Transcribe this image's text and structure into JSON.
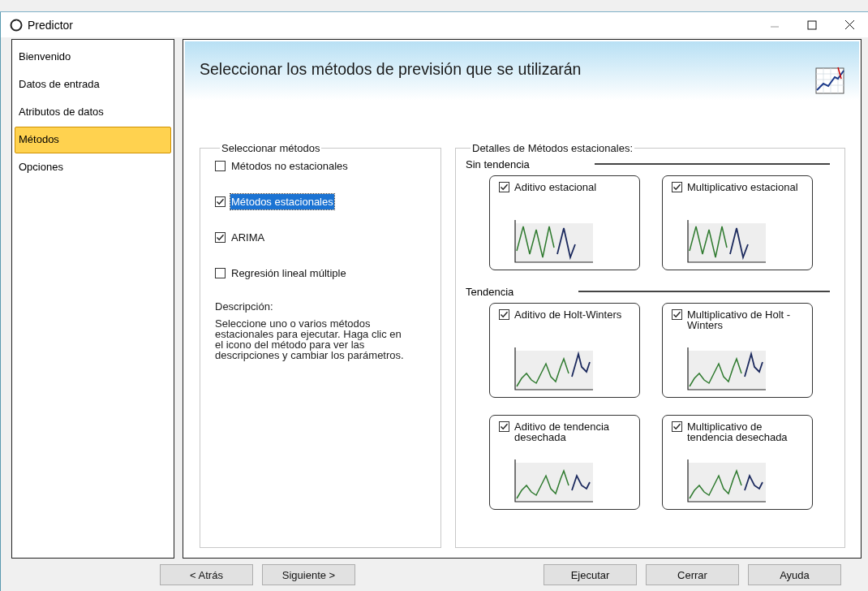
{
  "window": {
    "title": "Predictor"
  },
  "sidebar": {
    "items": [
      {
        "label": "Bienvenido",
        "selected": false
      },
      {
        "label": "Datos de entrada",
        "selected": false
      },
      {
        "label": "Atributos de datos",
        "selected": false
      },
      {
        "label": "Métodos",
        "selected": true
      },
      {
        "label": "Opciones",
        "selected": false
      }
    ]
  },
  "header": {
    "title": "Seleccionar los métodos de previsión que se utilizarán"
  },
  "select_methods": {
    "title": "Seleccionar métodos",
    "items": [
      {
        "label": "Métodos no estacionales",
        "checked": false,
        "selected": false
      },
      {
        "label": "Métodos estacionales",
        "checked": true,
        "selected": true
      },
      {
        "label": "ARIMA",
        "checked": true,
        "selected": false
      },
      {
        "label": "Regresión lineal múltiple",
        "checked": false,
        "selected": false
      }
    ],
    "description_label": "Descripción:",
    "description": "Seleccione uno o varios métodos estacionales para ejecutar. Haga clic en el icono del método para ver las descripciones y cambiar los parámetros."
  },
  "details": {
    "title": "Detalles de Métodos estacionales:",
    "groups": [
      {
        "title": "Sin tendencia",
        "methods": [
          {
            "label": "Aditivo estacional",
            "checked": true,
            "kind": "seasonal"
          },
          {
            "label": "Multiplicativo estacional",
            "checked": true,
            "kind": "seasonal"
          }
        ]
      },
      {
        "title": "Tendencia",
        "methods": [
          {
            "label": "Aditivo de Holt-Winters",
            "checked": true,
            "kind": "trend"
          },
          {
            "label": "Multiplicativo de Holt -Winters",
            "checked": true,
            "kind": "trend"
          },
          {
            "label": "Aditivo de tendencia desechada",
            "checked": true,
            "kind": "damped"
          },
          {
            "label": "Multiplicativo de tendencia desechada",
            "checked": true,
            "kind": "damped"
          }
        ]
      }
    ]
  },
  "buttons": [
    "< Atrás",
    "Siguiente >",
    "Ejecutar",
    "Cerrar",
    "Ayuda"
  ]
}
